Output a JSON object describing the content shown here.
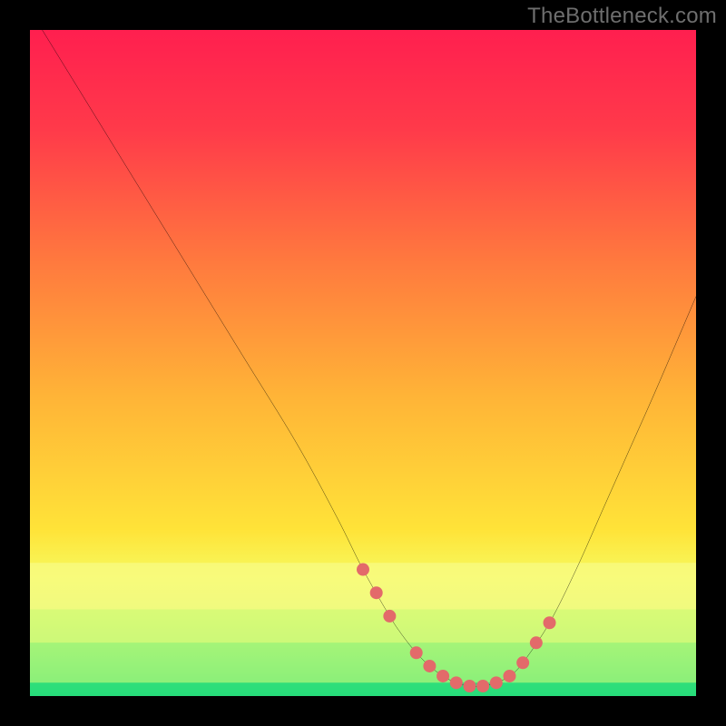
{
  "watermark": "TheBottleneck.com",
  "chart_data": {
    "type": "line",
    "title": "",
    "xlabel": "",
    "ylabel": "",
    "xlim": [
      0,
      100
    ],
    "ylim": [
      0,
      100
    ],
    "grid": false,
    "series": [
      {
        "name": "bottleneck-curve",
        "color": "#000000",
        "x": [
          0,
          8,
          16,
          24,
          32,
          40,
          46,
          50,
          54,
          56,
          58,
          60,
          62,
          64,
          66,
          68,
          70,
          72,
          74,
          78,
          82,
          86,
          90,
          94,
          100
        ],
        "y": [
          103,
          90,
          77,
          64,
          51,
          38,
          27,
          19,
          12,
          9,
          6.5,
          4.5,
          3,
          2,
          1.5,
          1.5,
          2,
          3,
          5,
          11,
          19,
          28,
          37,
          46,
          60
        ]
      }
    ],
    "markers": {
      "name": "tolerance-points",
      "color": "#e36a6a",
      "radius": 7,
      "x": [
        50,
        52,
        54,
        58,
        60,
        62,
        64,
        66,
        68,
        70,
        72,
        74,
        76,
        78
      ],
      "y": [
        19,
        15.5,
        12,
        6.5,
        4.5,
        3,
        2,
        1.5,
        1.5,
        2,
        3,
        5,
        8,
        11
      ]
    },
    "bands": [
      {
        "name": "yellow-soft",
        "y0": 13,
        "y1": 20,
        "color": "#f8fb84"
      },
      {
        "name": "lime-soft",
        "y0": 8,
        "y1": 13,
        "color": "#d9fb7a"
      },
      {
        "name": "green-soft",
        "y0": 2,
        "y1": 8,
        "color": "#a3f47a"
      },
      {
        "name": "green-core",
        "y0": 0,
        "y1": 2,
        "color": "#28dd7b"
      }
    ],
    "gradient_stops": [
      {
        "offset": 0.0,
        "color": "#ff1f4f"
      },
      {
        "offset": 0.15,
        "color": "#ff3a4a"
      },
      {
        "offset": 0.35,
        "color": "#ff7a3e"
      },
      {
        "offset": 0.55,
        "color": "#ffb437"
      },
      {
        "offset": 0.75,
        "color": "#ffe338"
      },
      {
        "offset": 0.82,
        "color": "#f6f95e"
      },
      {
        "offset": 0.87,
        "color": "#d6f86f"
      },
      {
        "offset": 0.93,
        "color": "#9bf076"
      },
      {
        "offset": 1.0,
        "color": "#23db7a"
      }
    ]
  }
}
